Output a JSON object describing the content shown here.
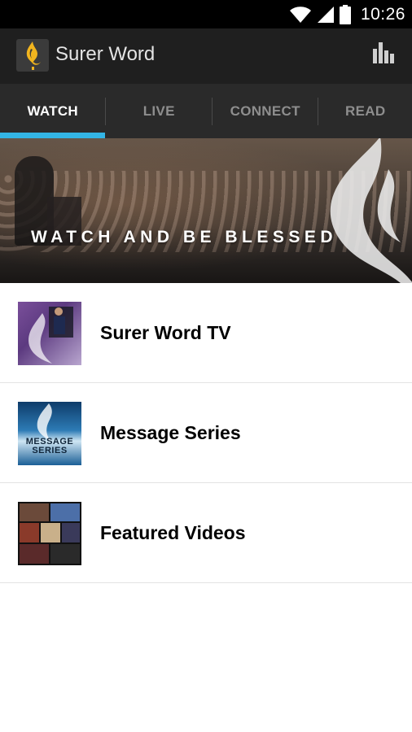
{
  "status_bar": {
    "time": "10:26",
    "icons": [
      "wifi-icon",
      "signal-icon",
      "battery-icon"
    ]
  },
  "app_bar": {
    "title": "Surer Word",
    "logo_icon": "flame-logo-icon",
    "action_icon": "bar-chart-icon"
  },
  "tabs": [
    {
      "label": "WATCH",
      "active": true
    },
    {
      "label": "LIVE",
      "active": false
    },
    {
      "label": "CONNECT",
      "active": false
    },
    {
      "label": "READ",
      "active": false
    }
  ],
  "banner": {
    "text": "WATCH AND BE BLESSED"
  },
  "list": {
    "items": [
      {
        "label": "Surer Word TV",
        "thumbnail": "surer-word-tv-thumbnail"
      },
      {
        "label": "Message Series",
        "thumbnail": "message-series-thumbnail",
        "thumbnail_text": "MESSAGE SERIES"
      },
      {
        "label": "Featured Videos",
        "thumbnail": "featured-videos-thumbnail"
      }
    ]
  },
  "colors": {
    "status_bar_bg": "#000000",
    "app_bar_bg": "#1f1f1f",
    "tab_bar_bg": "#2a2a2a",
    "tab_indicator": "#33b5e5",
    "logo_flame": "#f2b51e"
  }
}
